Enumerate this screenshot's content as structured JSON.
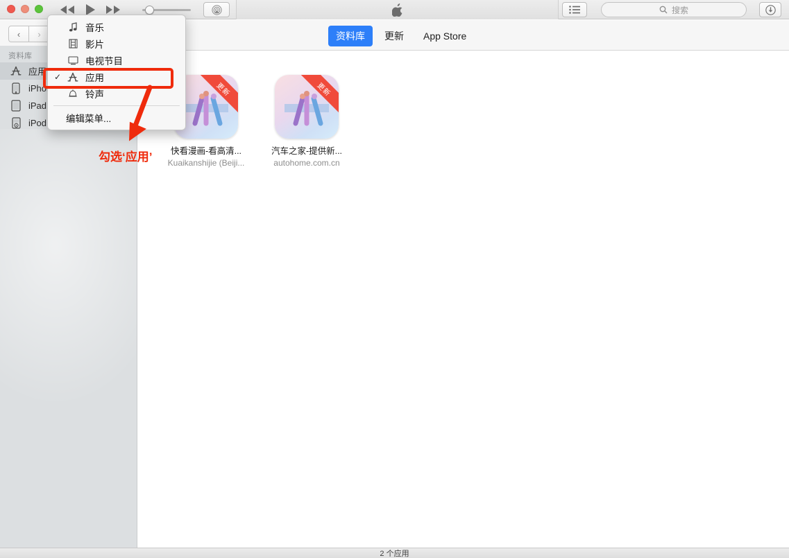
{
  "toolbar": {
    "window_controls": [
      "close",
      "minimize",
      "zoom"
    ],
    "rewind_label": "rewind",
    "play_label": "play",
    "forward_label": "fast-forward",
    "volume_label": "volume",
    "airplay_label": "AirPlay",
    "apple_logo_label": "Apple",
    "list_view_label": "list view",
    "download_label": "downloads",
    "search": {
      "placeholder": "搜索",
      "value": ""
    }
  },
  "navbar": {
    "back_label": "‹",
    "forward_label": "›",
    "tabs": [
      {
        "label": "资料库",
        "active": true
      },
      {
        "label": "更新",
        "active": false
      },
      {
        "label": "App Store",
        "active": false
      }
    ]
  },
  "sidebar": {
    "header": "资料库",
    "items": [
      {
        "label": "应用",
        "icon": "app-store-icon",
        "selected": true
      },
      {
        "label": "iPhone",
        "icon": "iphone-icon",
        "selected": false
      },
      {
        "label": "iPad",
        "icon": "ipad-icon",
        "selected": false
      },
      {
        "label": "iPod",
        "icon": "ipod-icon",
        "selected": false
      }
    ]
  },
  "menu": {
    "items": [
      {
        "label": "音乐",
        "icon": "music-note-icon",
        "checked": false
      },
      {
        "label": "影片",
        "icon": "film-icon",
        "checked": false
      },
      {
        "label": "电视节目",
        "icon": "tv-icon",
        "checked": false
      },
      {
        "label": "应用",
        "icon": "app-store-icon",
        "checked": true
      },
      {
        "label": "铃声",
        "icon": "bell-icon",
        "checked": false
      }
    ],
    "edit_label": "编辑菜单...",
    "check_glyph": "✓"
  },
  "content": {
    "apps": [
      {
        "name": "快看漫画-看高清...",
        "developer": "Kuaikanshijie (Beiji...",
        "badge": "更新"
      },
      {
        "name": "汽车之家-提供新...",
        "developer": "autohome.com.cn",
        "badge": "更新"
      }
    ]
  },
  "statusbar": {
    "text": "2 个应用"
  },
  "annotations": {
    "callout_text": "勾选‘应用’",
    "highlight_color": "#ef2b0c"
  },
  "colors": {
    "accent_blue": "#2d7ff9",
    "annotation_red": "#ef2b0c",
    "badge_red": "#f04a3a",
    "sidebar_bg": "#dcdfe1"
  }
}
